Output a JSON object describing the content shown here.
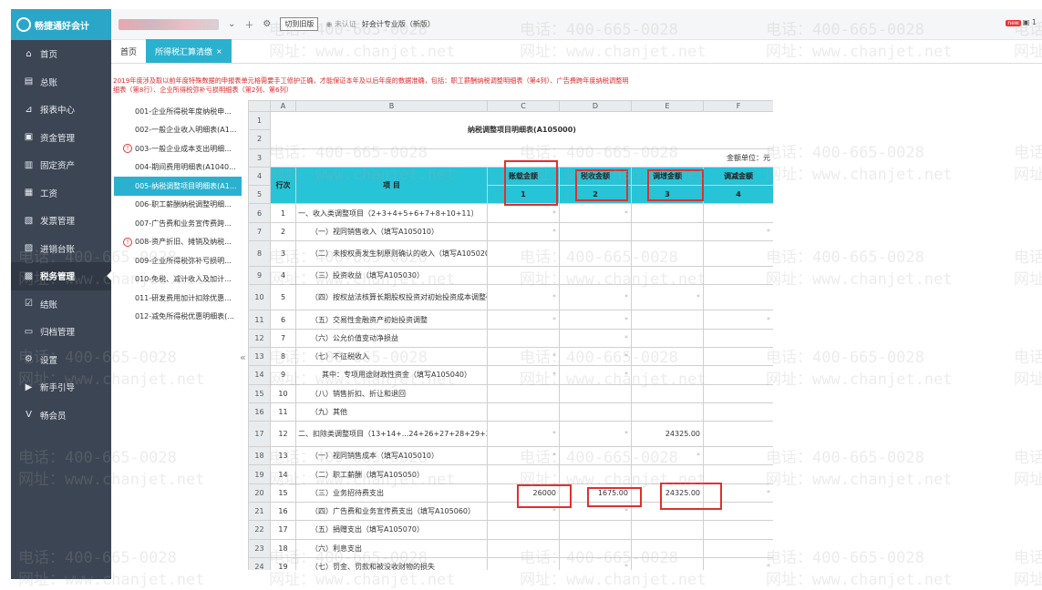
{
  "app": {
    "logo_text": "畅捷通好会计",
    "product_name": "好会计专业版（新版）",
    "switch_label": "切到旧版",
    "cert_label": "未认证",
    "top_right": "1"
  },
  "sidebar": {
    "items": [
      {
        "label": "首页",
        "icon": "home-icon",
        "glyph": "⌂"
      },
      {
        "label": "总账",
        "icon": "ledger-icon",
        "glyph": "▤"
      },
      {
        "label": "报表中心",
        "icon": "chart-icon",
        "glyph": "⊿"
      },
      {
        "label": "资金管理",
        "icon": "wallet-icon",
        "glyph": "▣"
      },
      {
        "label": "固定资产",
        "icon": "asset-icon",
        "glyph": "▥"
      },
      {
        "label": "工资",
        "icon": "salary-icon",
        "glyph": "▦"
      },
      {
        "label": "发票管理",
        "icon": "invoice-icon",
        "glyph": "▧"
      },
      {
        "label": "进销台账",
        "icon": "inventory-icon",
        "glyph": "▨"
      },
      {
        "label": "税务管理",
        "icon": "tax-icon",
        "glyph": "▩",
        "active": true
      },
      {
        "label": "结账",
        "icon": "checkout-icon",
        "glyph": "☑"
      },
      {
        "label": "归档管理",
        "icon": "archive-icon",
        "glyph": "▭"
      },
      {
        "label": "设置",
        "icon": "gear-icon",
        "glyph": "⚙"
      },
      {
        "label": "新手引导",
        "icon": "guide-icon",
        "glyph": "▶"
      },
      {
        "label": "畅会员",
        "icon": "vip-icon",
        "glyph": "V"
      }
    ]
  },
  "tabs": [
    {
      "label": "首页"
    },
    {
      "label": "所得税汇算清缴",
      "close": "×",
      "active": true
    }
  ],
  "notice": "2019年度涉及取以前年度特殊数据的申报表单元格需要手工修护正确，才能保证本年及以后年度的数据准确，包括：职工薪酬纳税调整明细表（第4列）、广告费跨年度纳税调整明细表（第8行）、企业所得税弥补亏损明细表（第2列、第6列）",
  "subnav": [
    {
      "label": "001-企业所得税年度纳税申..."
    },
    {
      "label": "002-一般企业收入明细表(A1..."
    },
    {
      "label": "003-一般企业成本支出明细...",
      "warn": true
    },
    {
      "label": "004-期间费用明细表(A1040..."
    },
    {
      "label": "005-纳税调整项目明细表(A1...",
      "active": true
    },
    {
      "label": "006-职工薪酬纳税调整明细..."
    },
    {
      "label": "007-广告费和业务宣传费跨..."
    },
    {
      "label": "008-资产折旧、摊销及纳税...",
      "warn": true
    },
    {
      "label": "009-企业所得税弥补亏损明..."
    },
    {
      "label": "010-免税、减计收入及加计..."
    },
    {
      "label": "011-研发费用加计扣除优惠..."
    },
    {
      "label": "012-减免所得税优惠明细表(..."
    }
  ],
  "sheet": {
    "col_letters": [
      "A",
      "B",
      "C",
      "D",
      "E",
      "F"
    ],
    "title": "纳税调整项目明细表(A105000)",
    "unit": "金额单位：元",
    "headers": {
      "seq": "行次",
      "item": "项 目",
      "c": "账载金额",
      "d": "税收金额",
      "e": "调增金额",
      "f": "调减金额",
      "c_num": "1",
      "d_num": "2",
      "e_num": "3",
      "f_num": "4"
    },
    "rows": [
      {
        "r": "6",
        "seq": "1",
        "item": "一、收入类调整项目（2+3+4+5+6+7+8+10+11）",
        "c": "*",
        "d": "*",
        "e": "",
        "f": ""
      },
      {
        "r": "7",
        "seq": "2",
        "item": "（一）视同销售收入（填写A105010）",
        "c": "*",
        "d": "",
        "e": "",
        "f": "*"
      },
      {
        "r": "8",
        "seq": "3",
        "item": "（二）未按权责发生制原则确认的收入（填写A105020）",
        "c": "",
        "d": "",
        "e": "",
        "f": "",
        "wrap": true
      },
      {
        "r": "9",
        "seq": "4",
        "item": "（三）投资收益（填写A105030）",
        "c": "",
        "d": "",
        "e": "",
        "f": ""
      },
      {
        "r": "10",
        "seq": "5",
        "item": "（四）按权益法核算长期股权投资对初始投资成本调整确认收益",
        "c": "*",
        "d": "*",
        "e": "*",
        "f": "",
        "wrap": true
      },
      {
        "r": "11",
        "seq": "6",
        "item": "（五）交易性金融资产初始投资调整",
        "c": "*",
        "d": "*",
        "e": "",
        "f": "*"
      },
      {
        "r": "12",
        "seq": "7",
        "item": "（六）公允价值变动净损益",
        "c": "",
        "d": "*",
        "e": "",
        "f": ""
      },
      {
        "r": "13",
        "seq": "8",
        "item": "（七）不征税收入",
        "c": "*",
        "d": "*",
        "e": "",
        "f": ""
      },
      {
        "r": "14",
        "seq": "9",
        "item": "其中：专项用途财政性资金（填写A105040）",
        "c": "*",
        "d": "*",
        "e": "",
        "f": "",
        "indent": true
      },
      {
        "r": "15",
        "seq": "10",
        "item": "（八）销售折扣、折让和退回",
        "c": "",
        "d": "",
        "e": "",
        "f": ""
      },
      {
        "r": "16",
        "seq": "11",
        "item": "（九）其他",
        "c": "",
        "d": "",
        "e": "",
        "f": ""
      },
      {
        "r": "17",
        "seq": "12",
        "item": "二、扣除类调整项目（13+14+...24+26+27+28+29+30）",
        "c": "*",
        "d": "*",
        "e": "24325.00",
        "f": "",
        "wrap": true
      },
      {
        "r": "18",
        "seq": "13",
        "item": "（一）视同销售成本（填写A105010）",
        "c": "*",
        "d": "",
        "e": "*",
        "f": ""
      },
      {
        "r": "19",
        "seq": "14",
        "item": "（二）职工薪酬（填写A105050）",
        "c": "",
        "d": "",
        "e": "",
        "f": ""
      },
      {
        "r": "20",
        "seq": "15",
        "item": "（三）业务招待费支出",
        "c": "26000",
        "d": "1675.00",
        "e": "24325.00",
        "f": "*"
      },
      {
        "r": "21",
        "seq": "16",
        "item": "（四）广告费和业务宣传费支出（填写A105060）",
        "c": "*",
        "d": "*",
        "e": "",
        "f": ""
      },
      {
        "r": "22",
        "seq": "17",
        "item": "（五）捐赠支出（填写A105070）",
        "c": "",
        "d": "",
        "e": "",
        "f": ""
      },
      {
        "r": "23",
        "seq": "18",
        "item": "（六）利息支出",
        "c": "",
        "d": "",
        "e": "",
        "f": ""
      },
      {
        "r": "24",
        "seq": "19",
        "item": "（七）罚金、罚款和被没收财物的损失",
        "c": "",
        "d": "*",
        "e": "",
        "f": "*"
      }
    ]
  },
  "watermark": {
    "phone": "电话：400-665-0028",
    "site": "网址：www.chanjet.net"
  }
}
